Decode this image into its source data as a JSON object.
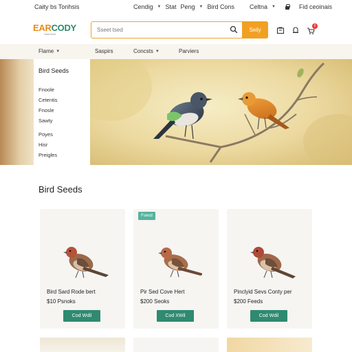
{
  "topbar": {
    "left_text": "Caity bs Tonhsis",
    "mid_items": [
      "Cendig",
      "Stat",
      "Peng",
      "Bird Cons"
    ],
    "right_items": [
      "Celtna",
      "Fid ceoinais"
    ]
  },
  "header": {
    "logo_text_a": "EAR",
    "logo_text_b": "CODY",
    "logo_sub": "Sast feed",
    "search_placeholder": "Sseet tsed",
    "search_button": "Seily",
    "cart_count": "0",
    "icons": [
      "search-icon",
      "bag-icon",
      "bell-icon",
      "cart-icon"
    ]
  },
  "nav": {
    "items": [
      "Flame",
      "Saspirs",
      "Concsts",
      "Parviers"
    ]
  },
  "hero": {
    "menu_title": "Bird Seeds",
    "menu_group_a": [
      "Fnoole",
      "Cetentis",
      "Fnosle",
      "Sawty"
    ],
    "menu_group_b": [
      "Poyes",
      "Hisr",
      "Preigles"
    ]
  },
  "section": {
    "title": "Bird Seeds"
  },
  "products": [
    {
      "tag": "",
      "name": "Bird Sard Rode bert",
      "price": "$10 Psnoks",
      "button": "Cod Wdil"
    },
    {
      "tag": "Fseod",
      "name": "Pir Sed Cove Hert",
      "price": "$200 Seoks",
      "button": "Cod XWil"
    },
    {
      "tag": "",
      "name": "Pinclyid Sevs Conty per",
      "price": "$200 Feeds",
      "button": "Cod Wdil"
    }
  ],
  "colors": {
    "accent_orange": "#f2a024",
    "accent_green": "#2f8a70",
    "nav_bg": "#f8f4ee"
  }
}
